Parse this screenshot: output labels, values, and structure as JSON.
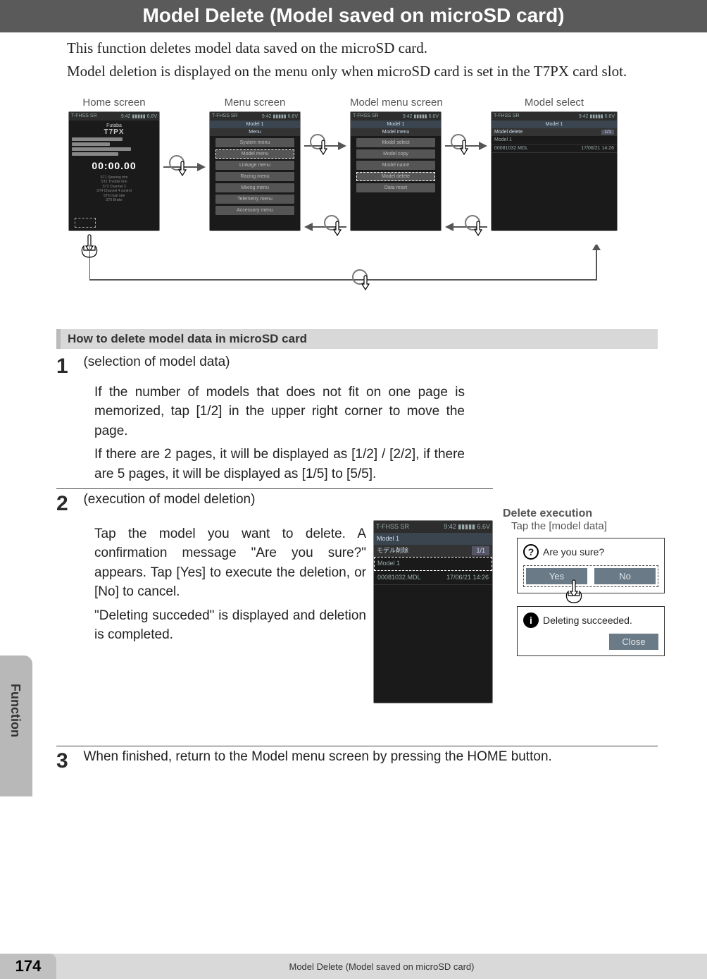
{
  "title": "Model Delete (Model saved on microSD card)",
  "intro": {
    "p1": "This function deletes model data saved on the microSD card.",
    "p2": "Model deletion is displayed on the menu only when microSD card is set in the T7PX card slot."
  },
  "nav": {
    "home_label": "Home screen",
    "menu_label": "Menu screen",
    "modelmenu_label": "Model menu screen",
    "modelselect_label": "Model select",
    "status_left": "T-FHSS SR",
    "status_right": "9:42  ▮▮▮▮▮ 6.6V",
    "model_line": "Model 1",
    "home": {
      "brand": "Futaba",
      "product": "T7PX",
      "timer": "00:00.00"
    },
    "menu": {
      "title": "Menu",
      "items": [
        "System menu",
        "Model menu",
        "Linkage menu",
        "Racing menu",
        "Mixing menu",
        "Telemetry menu",
        "Accessory menu"
      ],
      "highlight_index": 1
    },
    "model_menu": {
      "title": "Model menu",
      "items": [
        "Model select",
        "Model copy",
        "Model name",
        "Model delete",
        "Data reset"
      ],
      "highlight_index": 3
    },
    "model_select": {
      "title": "Model delete",
      "page_indicator": "1/1",
      "item_name": "Model 1",
      "item_file": "00081032.MDL",
      "item_date": "17/06/21 14:26"
    }
  },
  "section_heading": "How to delete model data in microSD card",
  "steps": {
    "s1": {
      "num": "1",
      "heading": "(selection of model data)",
      "p1": "If the number of models that does not fit on one page is memorized, tap [1/2] in the upper right corner to move the page.",
      "p2": "If there are 2 pages, it will be displayed as [1/2] / [2/2], if there are 5 pages, it will be displayed as [1/5] to [5/5]."
    },
    "s2": {
      "num": "2",
      "heading": "(execution of model deletion)",
      "p1": "Tap the model you want to delete. A confirmation message \"Are you sure?\" appears. Tap [Yes] to execute the deletion, or [No] to cancel.",
      "p2": "\"Deleting succeded\" is displayed and deletion is completed.",
      "screen": {
        "title": "モデル削除",
        "page_indicator": "1/1",
        "item_name": "Model 1",
        "item_file": "00081032.MDL",
        "item_date": "17/06/21 14:26"
      }
    },
    "s3": {
      "num": "3",
      "text": "When finished, return to the Model menu screen by pressing the HOME button."
    }
  },
  "right_panel": {
    "title": "Delete execution",
    "sub": "Tap the [model data]",
    "confirm_text": "Are you sure?",
    "yes": "Yes",
    "no": "No",
    "success_text": "Deleting succeeded.",
    "close": "Close",
    "q_symbol": "?",
    "i_symbol": "i"
  },
  "side_tab": "Function",
  "footer": {
    "page_number": "174",
    "text": "Model Delete (Model saved on microSD card)"
  }
}
